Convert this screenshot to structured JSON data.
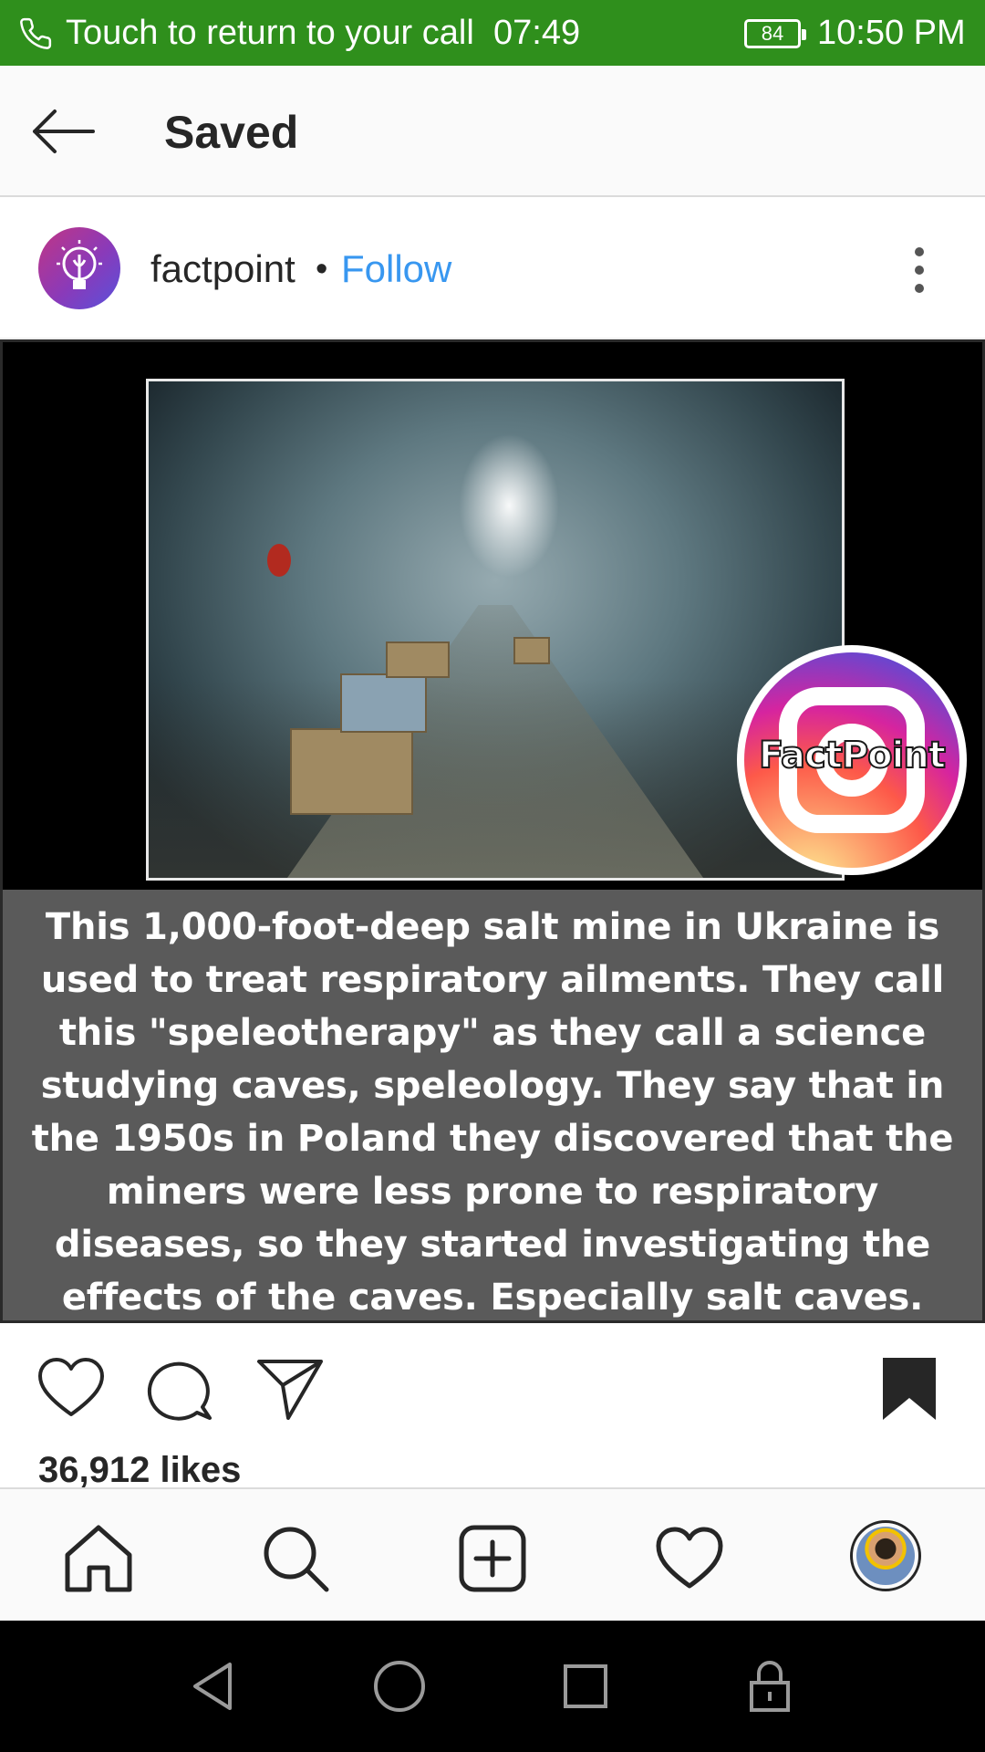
{
  "status_bar": {
    "call_text": "Touch to return to your call",
    "call_timer": "07:49",
    "battery": "84",
    "time": "10:50 PM"
  },
  "header": {
    "title": "Saved"
  },
  "post": {
    "username": "factpoint",
    "separator": "•",
    "follow_label": "Follow",
    "image": {
      "logo_text": "FactPoint",
      "caption": "This 1,000-foot-deep salt mine in Ukraine is used to treat respiratory ailments. They call this \"speleotherapy\" as they call a science studying caves, speleology. They say that in the 1950s in Poland they discovered that the miners were less prone to respiratory diseases, so they started investigating the effects of the caves. Especially salt caves."
    },
    "likes": "36,912 likes",
    "actions": [
      "heart-icon",
      "comment-icon",
      "send-icon",
      "bookmark-icon"
    ]
  },
  "bottom_nav": [
    "home-icon",
    "search-icon",
    "add-icon",
    "heart-icon",
    "profile-avatar"
  ],
  "system_nav": [
    "back-icon",
    "home-circle-icon",
    "recents-icon",
    "lock-icon"
  ],
  "colors": {
    "status_bar": "#2f8f1c",
    "follow": "#3897f0",
    "caption_panel": "#5a5a5a"
  }
}
